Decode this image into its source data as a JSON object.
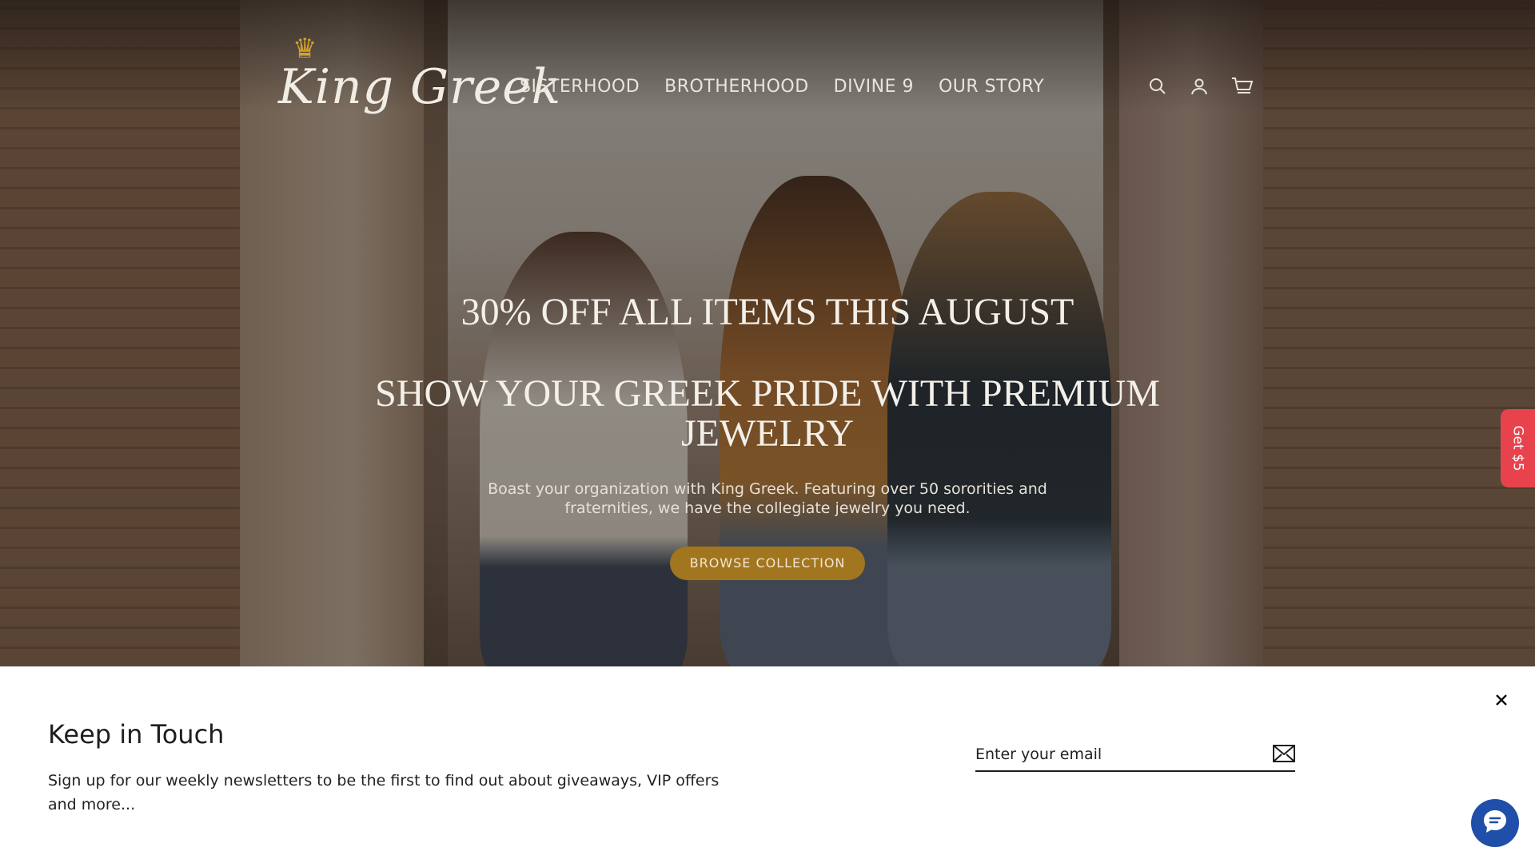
{
  "brand": {
    "name": "King Greek",
    "accent_color": "#a2761e",
    "crown_color": "#d4a12a"
  },
  "nav": {
    "items": [
      {
        "label": "SISTERHOOD"
      },
      {
        "label": "BROTHERHOOD"
      },
      {
        "label": "DIVINE 9"
      },
      {
        "label": "OUR STORY"
      }
    ]
  },
  "header_icons": [
    "search-icon",
    "account-icon",
    "cart-icon"
  ],
  "hero": {
    "promo": "30% OFF ALL ITEMS THIS AUGUST",
    "headline": "SHOW YOUR GREEK PRIDE WITH PREMIUM JEWELRY",
    "subtext": "Boast your organization with King Greek. Featuring over 50 sororities and fraternities, we have the collegiate jewelry you need.",
    "cta_label": "BROWSE COLLECTION"
  },
  "side_tab": {
    "label": "Get $5",
    "color": "#e8434d"
  },
  "newsletter": {
    "title": "Keep in Touch",
    "description": "Sign up for our weekly newsletters to be the first to find out about giveaways, VIP offers and more...",
    "email_placeholder": "Enter your email",
    "close_icon": "close-icon",
    "submit_icon": "envelope-icon"
  },
  "chat": {
    "icon": "chat-bubble-icon",
    "color": "#1f4fa8"
  }
}
